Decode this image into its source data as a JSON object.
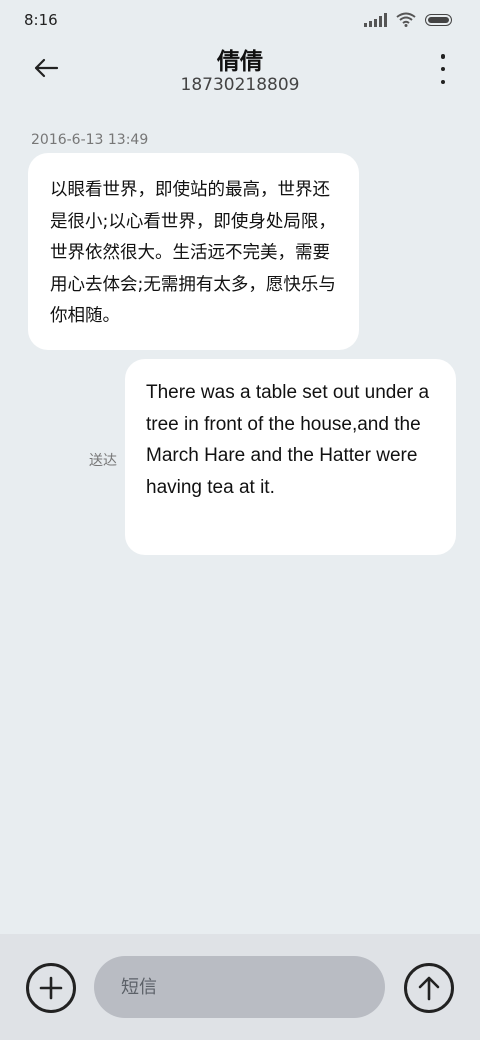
{
  "status_bar": {
    "time": "8:16",
    "icons": [
      "cellular-signal-icon",
      "wifi-icon",
      "battery-icon"
    ]
  },
  "header": {
    "contact_name": "倩倩",
    "phone_number": "18730218809",
    "back_icon": "arrow-left-icon",
    "more_icon": "more-vertical-icon"
  },
  "conversation": {
    "timestamp": "2016-6-13 13:49",
    "incoming_message": "以眼看世界，即使站的最高，世界还是很小;以心看世界，即使身处局限，世界依然很大。生活远不完美，需要用心去体会;无需拥有太多，愿快乐与你相随。",
    "outgoing_message": "There was a table set out under a tree in front of the house,and the March Hare and the Hatter were having tea at it.",
    "delivery_status": "送达"
  },
  "composer": {
    "placeholder": "短信",
    "add_icon": "plus-circle-icon",
    "send_icon": "arrow-up-circle-icon"
  },
  "colors": {
    "background": "#e8edf0",
    "bubble": "#ffffff",
    "composer_bar": "#dfe2e6",
    "input_field": "#b9bcc3"
  }
}
